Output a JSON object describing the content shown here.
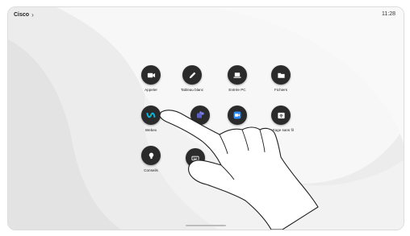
{
  "header": {
    "brand": "Cisco",
    "chevron": "›",
    "time": "11:28"
  },
  "apps": [
    {
      "label": "Appeler",
      "icon": "video-camera-icon"
    },
    {
      "label": "Tableau blanc",
      "icon": "pencil-icon"
    },
    {
      "label": "Entrée PC",
      "icon": "laptop-icon"
    },
    {
      "label": "Fichiers",
      "icon": "folder-icon"
    },
    {
      "label": "Webex",
      "icon": "webex-logo-icon"
    },
    {
      "label": "",
      "icon": "teams-logo-icon"
    },
    {
      "label": "",
      "icon": "zoom-logo-icon"
    },
    {
      "label": "Partage sans fil",
      "icon": "wireless-share-icon"
    },
    {
      "label": "Conseils",
      "icon": "lightbulb-icon"
    },
    {
      "label": "",
      "icon": "keyboard-icon"
    }
  ],
  "colors": {
    "button": "#2b2b2b",
    "webex_blue": "#07b6e9",
    "webex_green": "#4caf50",
    "teams_purple": "#5b5fc7",
    "zoom_blue": "#2d8cff"
  }
}
